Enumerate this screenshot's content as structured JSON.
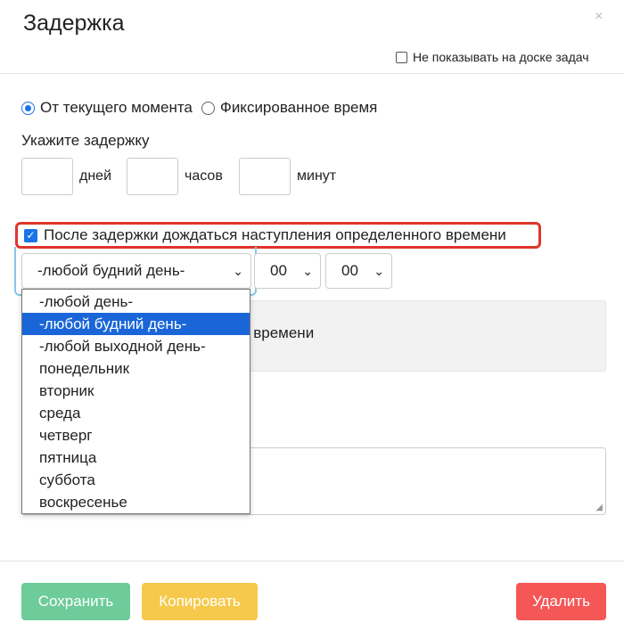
{
  "dialog": {
    "title": "Задержка",
    "close_symbol": "×",
    "hide_on_board_label": "Не показывать на доске задач",
    "hide_on_board_checked": false
  },
  "mode": {
    "options": [
      {
        "label": "От текущего момента",
        "selected": true
      },
      {
        "label": "Фиксированное время",
        "selected": false
      }
    ]
  },
  "delay": {
    "label": "Укажите задержку",
    "days_value": "",
    "days_unit": "дней",
    "hours_value": "",
    "hours_unit": "часов",
    "minutes_value": "",
    "minutes_unit": "минут"
  },
  "wait": {
    "checkbox_label": "После задержки дождаться наступления определенного времени",
    "checked": true,
    "day_select_value": "-любой будний день-",
    "hour_select_value": "00",
    "minute_select_value": "00"
  },
  "panel": {
    "visible_text": "и времени"
  },
  "dropdown": {
    "options": [
      "-любой день-",
      "-любой будний день-",
      "-любой выходной день-",
      "понедельник",
      "вторник",
      "среда",
      "четверг",
      "пятница",
      "суббота",
      "воскресенье"
    ],
    "selected_index": 1
  },
  "footer": {
    "save_label": "Сохранить",
    "copy_label": "Копировать",
    "delete_label": "Удалить"
  },
  "colors": {
    "accent": "#1a73e8",
    "highlight_border": "#e0352b",
    "save": "#6dcc9a",
    "copy": "#f6c94c",
    "delete": "#f55656"
  }
}
